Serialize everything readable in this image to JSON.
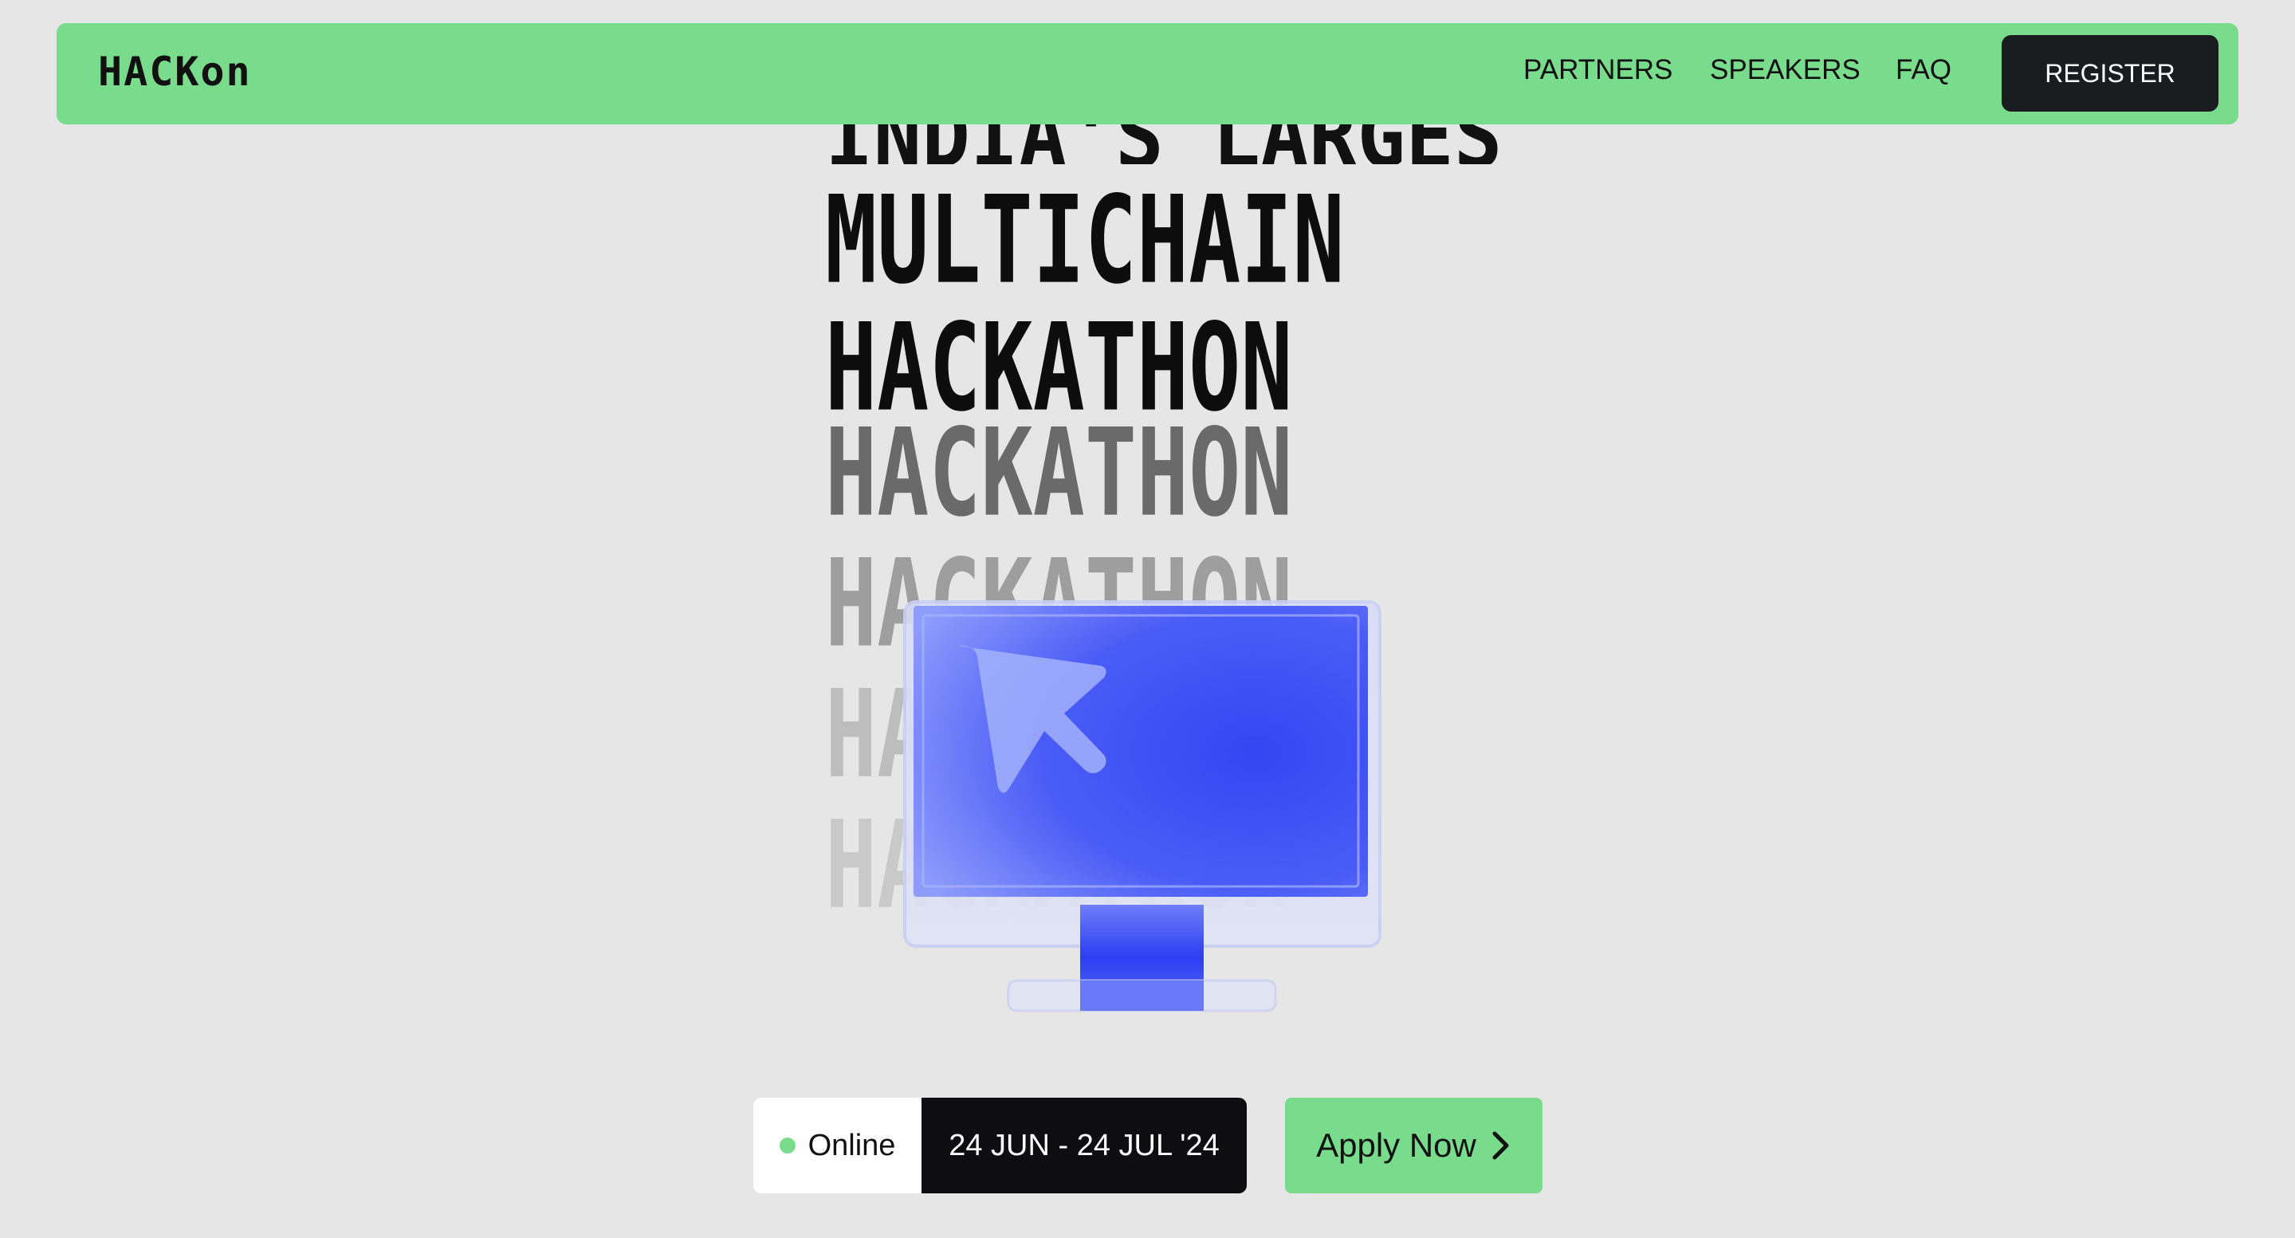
{
  "nav": {
    "logo": "HACKon",
    "links": [
      "PARTNERS",
      "SPEAKERS",
      "FAQ"
    ],
    "register_label": "REGISTER"
  },
  "hero": {
    "line1": "INDIA'S LARGEST",
    "line2": "MULTICHAIN",
    "line3": "HACKATHON",
    "echoes": [
      "HACKATHON",
      "HACKATHON",
      "HACKATHON",
      "HACKATHON"
    ]
  },
  "event": {
    "mode": "Online",
    "dates": "24 JUN - 24 JUL '24"
  },
  "cta": {
    "apply_label": "Apply Now"
  },
  "colors": {
    "accent_green": "#79db8c",
    "background": "#e6e6e6",
    "dark": "#1b1c20",
    "monitor_blue": "#3d4ef5"
  },
  "icons": [
    "pointer-cursor-icon",
    "chevron-right-icon",
    "status-dot-icon"
  ]
}
